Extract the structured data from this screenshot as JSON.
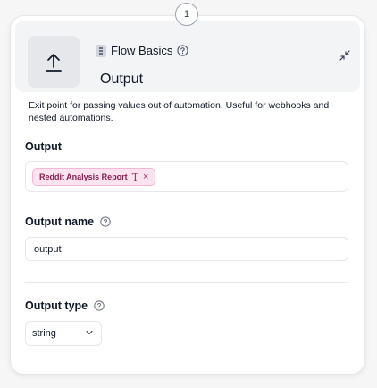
{
  "step": {
    "number": "1"
  },
  "node": {
    "category": "Flow Basics",
    "title": "Output",
    "description": "Exit point for passing values out of automation. Useful for webhooks and nested automations.",
    "icon": "upload-arrow-icon"
  },
  "output": {
    "label": "Output",
    "chip": {
      "label": "Reddit Analysis Report",
      "type_glyph": "T",
      "remove_glyph": "×"
    }
  },
  "output_name": {
    "label": "Output name",
    "value": "output"
  },
  "output_type": {
    "label": "Output type",
    "value": "string"
  },
  "colors": {
    "chip_bg": "#fbe4f0",
    "chip_text": "#8a1e4f",
    "header_bg": "#f3f4f6"
  }
}
